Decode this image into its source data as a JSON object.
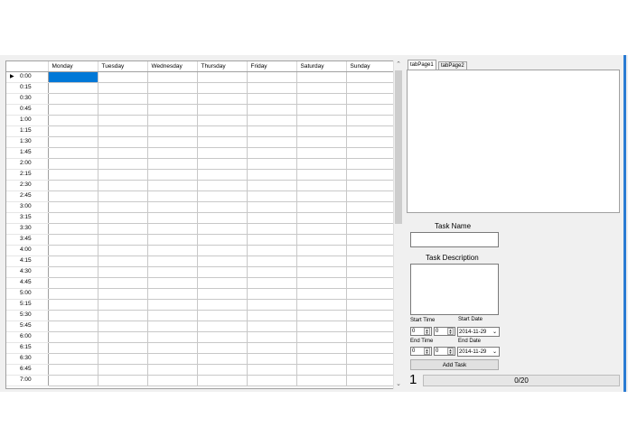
{
  "grid": {
    "columns": [
      "Monday",
      "Tuesday",
      "Wednesday",
      "Thursday",
      "Friday",
      "Saturday",
      "Sunday"
    ],
    "rows": [
      "0:00",
      "0:15",
      "0:30",
      "0:45",
      "1:00",
      "1:15",
      "1:30",
      "1:45",
      "2:00",
      "2:15",
      "2:30",
      "2:45",
      "3:00",
      "3:15",
      "3:30",
      "3:45",
      "4:00",
      "4:15",
      "4:30",
      "4:45",
      "5:00",
      "5:15",
      "5:30",
      "5:45",
      "6:00",
      "6:15",
      "6:30",
      "6:45",
      "7:00"
    ],
    "current_row_marker": "▶"
  },
  "tabs": [
    {
      "label": "tabPage1"
    },
    {
      "label": "tabPage2"
    }
  ],
  "form": {
    "task_name_label": "Task Name",
    "task_name_value": "",
    "task_description_label": "Task Description",
    "task_description_value": "",
    "start_time_label": "Start Time",
    "start_hour": "0",
    "start_minute": "0",
    "start_date_label": "Start Date",
    "start_date": "2014-11-29",
    "end_time_label": "End Time",
    "end_hour": "0",
    "end_minute": "0",
    "end_date_label": "End Date",
    "end_date": "2014-11-29",
    "add_task_label": "Add Task"
  },
  "status": {
    "page_number": "1",
    "progress_text": "0/20",
    "progress_fraction": 0
  },
  "colors": {
    "selection": "#0078d7",
    "progress_fill": "#06b025",
    "window_bg": "#f0f0f0"
  }
}
